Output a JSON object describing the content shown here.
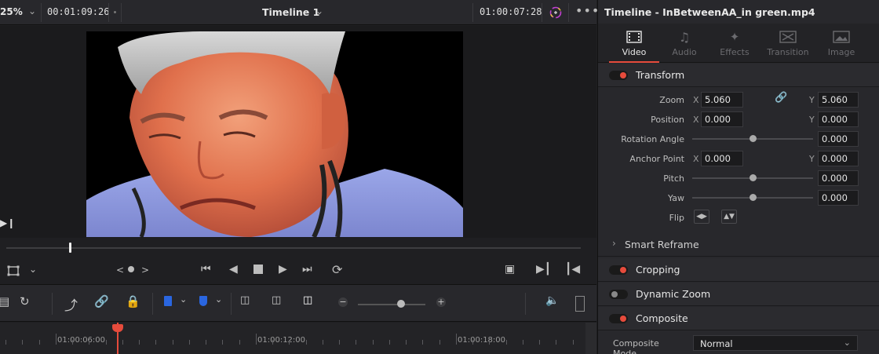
{
  "viewer_header": {
    "zoom": "25%",
    "source_timecode": "00:01:09:26",
    "timeline_name": "Timeline 1",
    "record_timecode": "01:00:07:28"
  },
  "ruler": {
    "labels": [
      "01:00:06:00",
      "01:00:12:00",
      "01:00:18:00"
    ]
  },
  "inspector": {
    "title": "Timeline - InBetweenAA_in green.mp4",
    "tabs": [
      {
        "label": "Video",
        "active": true,
        "icon": "film-icon"
      },
      {
        "label": "Audio",
        "active": false,
        "icon": "music-note-icon"
      },
      {
        "label": "Effects",
        "active": false,
        "icon": "magic-wand-icon"
      },
      {
        "label": "Transition",
        "active": false,
        "icon": "transition-icon"
      },
      {
        "label": "Image",
        "active": false,
        "icon": "image-icon"
      }
    ],
    "transform": {
      "title": "Transform",
      "enabled": true,
      "zoom_label": "Zoom",
      "zoom_x": "5.060",
      "zoom_y": "5.060",
      "position_label": "Position",
      "position_x": "0.000",
      "position_y": "0.000",
      "rotation_label": "Rotation Angle",
      "rotation": "0.000",
      "anchor_label": "Anchor Point",
      "anchor_x": "0.000",
      "anchor_y": "0.000",
      "pitch_label": "Pitch",
      "pitch": "0.000",
      "yaw_label": "Yaw",
      "yaw": "0.000",
      "flip_label": "Flip",
      "x_axis": "X",
      "y_axis": "Y"
    },
    "smart_reframe": {
      "title": "Smart Reframe"
    },
    "cropping": {
      "title": "Cropping",
      "enabled": true
    },
    "dynamic_zoom": {
      "title": "Dynamic Zoom",
      "enabled": false
    },
    "composite": {
      "title": "Composite",
      "enabled": true,
      "mode_label": "Composite Mode",
      "mode_value": "Normal"
    }
  },
  "colors": {
    "accent": "#e64b3c",
    "panel_bg": "#28282c"
  }
}
